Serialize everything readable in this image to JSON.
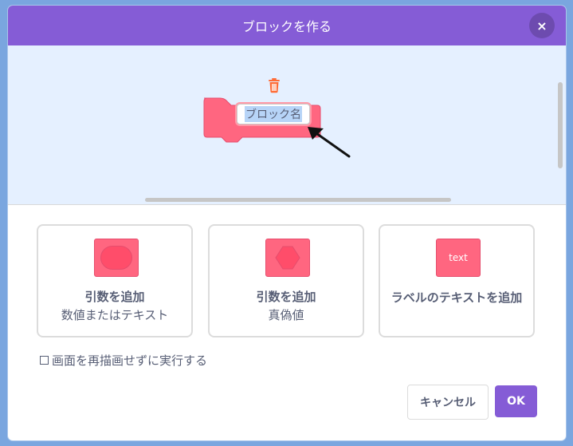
{
  "header": {
    "title": "ブロックを作る",
    "close_label": "×"
  },
  "workspace": {
    "block_name": "ブロック名"
  },
  "options": [
    {
      "title": "引数を追加",
      "subtitle": "数値またはテキスト",
      "icon": "round-input-icon"
    },
    {
      "title": "引数を追加",
      "subtitle": "真偽値",
      "icon": "boolean-input-icon"
    },
    {
      "title": "ラベルのテキストを追加",
      "subtitle": "",
      "icon": "text-label-icon",
      "icon_text": "text"
    }
  ],
  "checkbox": {
    "label": "画面を再描画せずに実行する",
    "checked": false
  },
  "footer": {
    "cancel_label": "キャンセル",
    "ok_label": "OK"
  },
  "colors": {
    "header": "#855cd6",
    "block": "#ff6680",
    "workspace_bg": "#e5f0ff",
    "trash": "#ff6b35"
  }
}
